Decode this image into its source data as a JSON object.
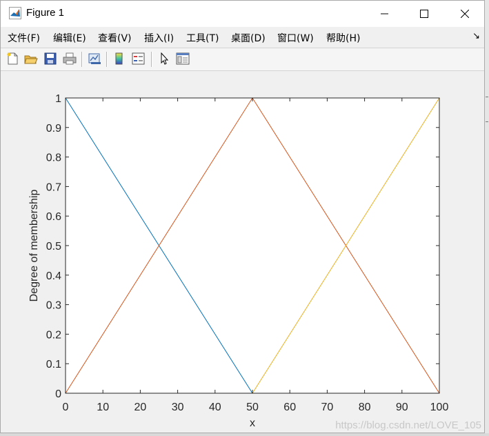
{
  "window": {
    "title": "Figure 1"
  },
  "menu": {
    "items": [
      {
        "label": "文件(F)"
      },
      {
        "label": "编辑(E)"
      },
      {
        "label": "查看(V)"
      },
      {
        "label": "插入(I)"
      },
      {
        "label": "工具(T)"
      },
      {
        "label": "桌面(D)"
      },
      {
        "label": "窗口(W)"
      },
      {
        "label": "帮助(H)"
      }
    ]
  },
  "toolbar": {
    "buttons": [
      {
        "icon": "new-figure-icon"
      },
      {
        "icon": "open-file-icon"
      },
      {
        "icon": "save-icon"
      },
      {
        "icon": "print-icon"
      },
      {
        "icon": "link-plot-icon"
      },
      {
        "icon": "colorbar-icon"
      },
      {
        "icon": "legend-icon"
      },
      {
        "icon": "pointer-icon"
      },
      {
        "icon": "property-editor-icon"
      }
    ]
  },
  "chart_data": {
    "type": "line",
    "title": "",
    "xlabel": "x",
    "ylabel": "Degree of membership",
    "xlim": [
      0,
      100
    ],
    "ylim": [
      0,
      1
    ],
    "xticks": [
      "0",
      "10",
      "20",
      "30",
      "40",
      "50",
      "60",
      "70",
      "80",
      "90",
      "100"
    ],
    "yticks": [
      "0",
      "0.1",
      "0.2",
      "0.3",
      "0.4",
      "0.5",
      "0.6",
      "0.7",
      "0.8",
      "0.9",
      "1"
    ],
    "grid": false,
    "legend": false,
    "series": [
      {
        "x": [
          0,
          50,
          100
        ],
        "y": [
          1,
          0,
          0
        ],
        "color": "#0072bd"
      },
      {
        "x": [
          0,
          50,
          100
        ],
        "y": [
          0,
          1,
          0
        ],
        "color": "#d95319"
      },
      {
        "x": [
          0,
          50,
          100
        ],
        "y": [
          0,
          0,
          1
        ],
        "color": "#edb120"
      }
    ]
  },
  "watermark": "https://blog.csdn.net/LOVE_105"
}
